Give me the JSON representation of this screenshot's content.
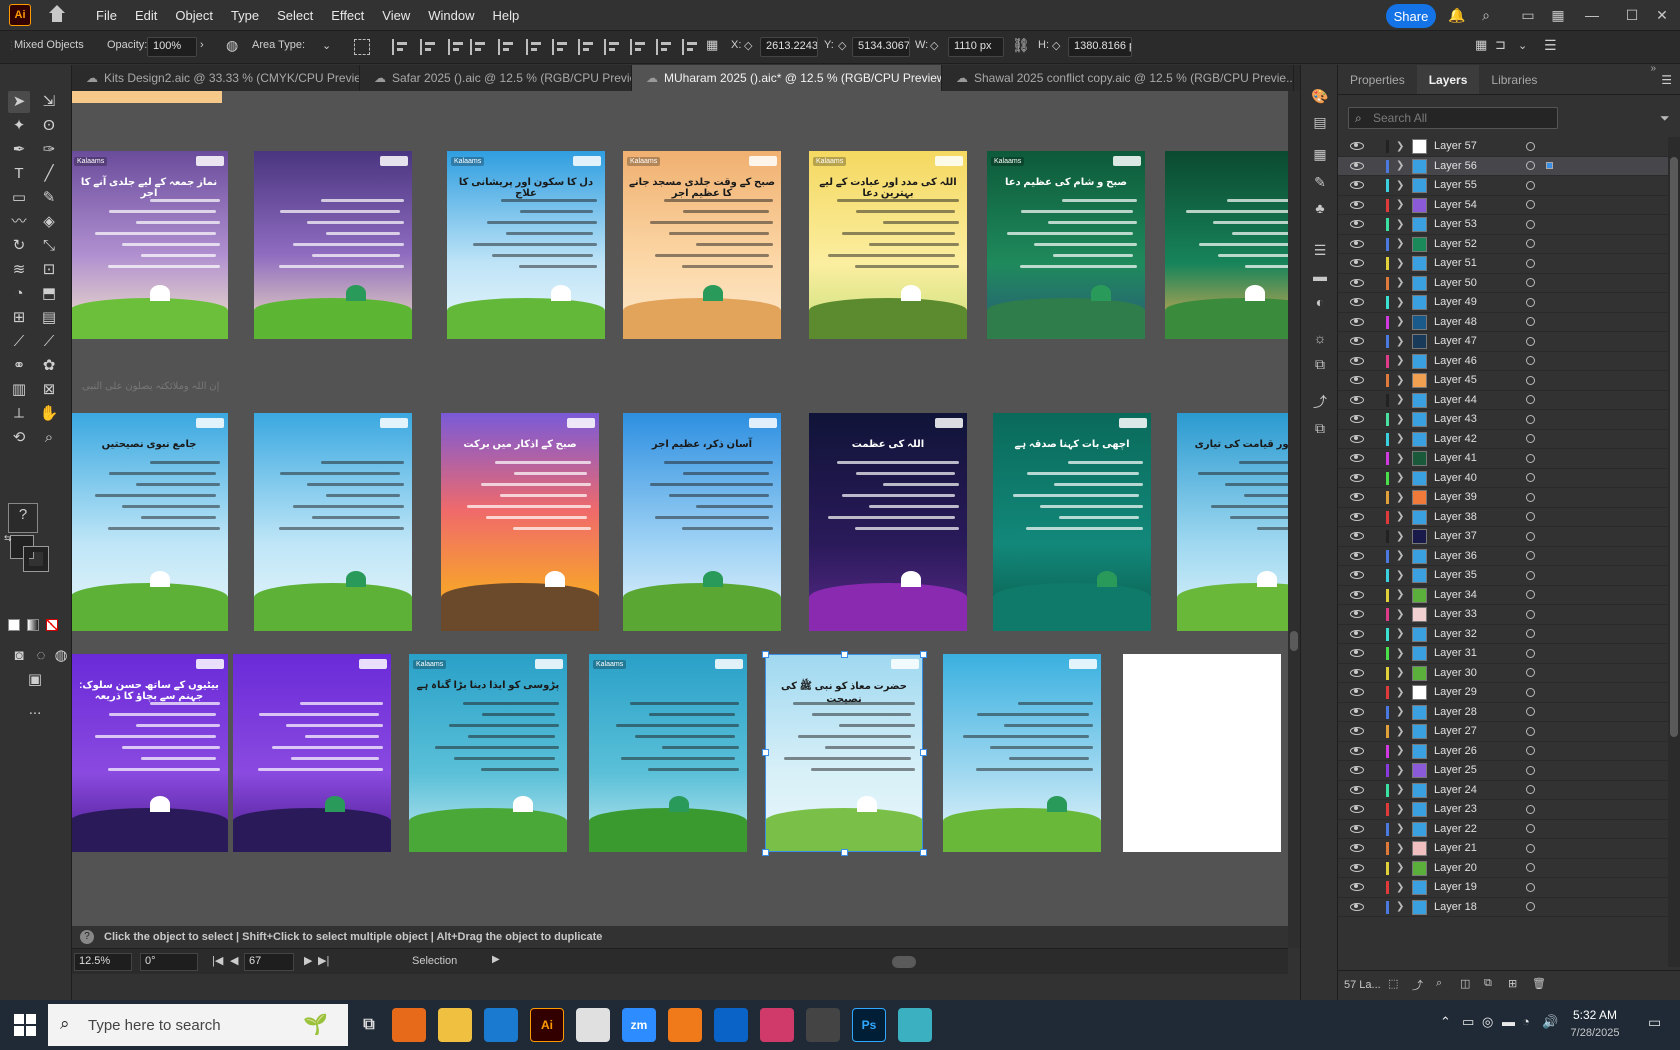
{
  "menubar": {
    "app_logo": "Ai",
    "items": [
      "File",
      "Edit",
      "Object",
      "Type",
      "Select",
      "Effect",
      "View",
      "Window",
      "Help"
    ],
    "share": "Share"
  },
  "control": {
    "selection_type": "Mixed Objects",
    "opacity_label": "Opacity:",
    "opacity_value": "100%",
    "area_type_label": "Area Type:",
    "x_label": "X:",
    "x_value": "2613.2243 p",
    "y_label": "Y:",
    "y_value": "5134.3067 p",
    "w_label": "W:",
    "w_value": "1110 px",
    "h_label": "H:",
    "h_value": "1380.8166 p"
  },
  "tabs": [
    {
      "label": "Kits Design2.aic @ 33.33 % (CMYK/CPU Previe...",
      "active": false
    },
    {
      "label": "Safar 2025 ().aic @ 12.5 % (RGB/CPU Previe...",
      "active": false
    },
    {
      "label": "MUharam 2025 ().aic* @ 12.5 % (RGB/CPU Preview)",
      "active": true
    },
    {
      "label": "Shawal 2025 conflict copy.aic @ 12.5 % (RGB/CPU Previe...",
      "active": false
    }
  ],
  "toolbar": {
    "help_glyph": "?",
    "more": "..."
  },
  "artboards_row1": [
    {
      "title": "نماز جمعہ کے لیے جلدی آنے کا اجر",
      "logo": "Kalaams",
      "bg": "linear-gradient(#6a4c9c,#b08fd0 55%,#f3e6c8)",
      "ground": "#6bbf3b"
    },
    {
      "title": "",
      "logo": "",
      "bg": "linear-gradient(#4a3580,#8f6cc0 55%,#f1e0c0)",
      "ground": "#5db534"
    },
    {
      "title": "دل کا سکون اور پریشانی کا علاج",
      "logo": "Kalaams",
      "bg": "linear-gradient(#2f9ee0,#bfe4f7 60%,#e9f6fb)",
      "ground": "#63b83a"
    },
    {
      "title": "صبح کے وقت جلدی مسجد جانے کا عظیم اجر",
      "logo": "Kalaams",
      "bg": "linear-gradient(#f0b070,#fcd8a8 60%,#fde8cc)",
      "ground": "#e2a35a"
    },
    {
      "title": "اللہ کی مدد اور عبادت کے لیے بہترین دعا",
      "logo": "Kalaams",
      "bg": "linear-gradient(#f4d860,#fbeea0 60%,#c9e07a)",
      "ground": "#5c8a2e"
    },
    {
      "title": "صبح و شام کی عظیم دعا",
      "logo": "Kalaams",
      "bg": "linear-gradient(#0d5a3a,#1f8a5c 60%,#2a5a7a)",
      "ground": "#2e7d4a"
    },
    {
      "title": "",
      "logo": "",
      "bg": "linear-gradient(#0b4a30,#17845a 60%,#f0b050)",
      "ground": "#3b8b3c"
    }
  ],
  "artboards_row2": [
    {
      "title": "جامع نبوی نصیحتیں",
      "logo": "",
      "bg": "linear-gradient(#3aa8e0,#bfe6f7 60%,#e8f6fb)",
      "ground": "#5cb136"
    },
    {
      "title": "",
      "logo": "",
      "bg": "linear-gradient(#3aa8e0,#bfe6f7 60%,#e8f6fb)",
      "ground": "#5cb136"
    },
    {
      "title": "صبح کے اذکار میں برکت",
      "logo": "",
      "bg": "linear-gradient(#7a5ad8,#f06a6a 45%,#f7a030 80%)",
      "ground": "#6a4a2a"
    },
    {
      "title": "آسان ذکر، عظیم اجر",
      "logo": "",
      "bg": "linear-gradient(#2d8fe0,#9fd2f5 60%,#e6f4fb)",
      "ground": "#5aa833"
    },
    {
      "title": "اللہ کی عظمت",
      "logo": "",
      "bg": "linear-gradient(#101438,#2a1a5a 60%,#5a2a8a)",
      "ground": "#8a2ab0"
    },
    {
      "title": "اچھی بات کہنا صدقہ ہے",
      "logo": "",
      "bg": "linear-gradient(#0a6a5a,#12887a 60%,#0a5a4a)",
      "ground": "#0f7a6a"
    },
    {
      "title": "موت اور قیامت کی تیاری",
      "logo": "",
      "bg": "linear-gradient(#2a9ad0,#9fd8f0 60%,#e0f4fb)",
      "ground": "#6ab83a"
    }
  ],
  "artboards_row3": [
    {
      "title": "بیٹیوں کے ساتھ حسن سلوک: جہنم سے بچاؤ کا ذریعہ",
      "logo": "",
      "bg": "linear-gradient(#6a2ad8,#8a4ae0 60%,#4a1a8a)",
      "ground": "#2a1a5a"
    },
    {
      "title": "",
      "logo": "",
      "bg": "linear-gradient(#6a2ad8,#8a4ae0 60%,#4a1a8a)",
      "ground": "#2a1a5a"
    },
    {
      "title": "پڑوسی کو ایذا دینا بڑا گناہ ہے",
      "logo": "Kalaams",
      "bg": "linear-gradient(#2aa0c8,#5ac0d8 60%,#bfe8f0)",
      "ground": "#4aa838"
    },
    {
      "title": "",
      "logo": "Kalaams",
      "bg": "linear-gradient(#2aa0c8,#5ac0d8 60%,#bfe8f0)",
      "ground": "#3a9a30"
    },
    {
      "title": "حضرت معاذ کو نبی ﷺ کی نصیحت",
      "logo": "",
      "bg": "linear-gradient(#9fd8f0,#d8f0f8 60%,#e8f6fb)",
      "ground": "#7ac048"
    },
    {
      "title": "",
      "logo": "",
      "bg": "linear-gradient(#3ab0e0,#9fd8f0 60%,#e8f6fb)",
      "ground": "#6ab83a"
    },
    {
      "title": "",
      "logo": "",
      "bg": "#ffffff",
      "ground": "#ffffff"
    }
  ],
  "stray_text": "إن اللہ وملائکتہ یصلون علی النبی",
  "status": {
    "hint": "Click the object to select  |  Shift+Click to select multiple object  |  Alt+Drag the object to duplicate",
    "zoom": "12.5%",
    "rotation": "0°",
    "artboard_num": "67",
    "mode": "Selection"
  },
  "panel": {
    "tabs": [
      "Properties",
      "Layers",
      "Libraries"
    ],
    "active_tab": "Layers",
    "search_placeholder": "Search All",
    "footer_count": "57 La..."
  },
  "layers": [
    {
      "name": "Layer 57",
      "color": "#222222",
      "thumb": "#ffffff"
    },
    {
      "name": "Layer 56",
      "color": "#4a7ae0",
      "thumb": "#3aa0e0",
      "active": true
    },
    {
      "name": "Layer 55",
      "color": "#3ad0e0",
      "thumb": "#3aa0e0"
    },
    {
      "name": "Layer 54",
      "color": "#e03a3a",
      "thumb": "#8a5ad8"
    },
    {
      "name": "Layer 53",
      "color": "#3ae0a0",
      "thumb": "#3aa0e0"
    },
    {
      "name": "Layer 52",
      "color": "#4a7ae0",
      "thumb": "#1a8a5a"
    },
    {
      "name": "Layer 51",
      "color": "#e0d03a",
      "thumb": "#3aa0e0"
    },
    {
      "name": "Layer 50",
      "color": "#e07a3a",
      "thumb": "#3aa0e0"
    },
    {
      "name": "Layer 49",
      "color": "#3ae0d0",
      "thumb": "#3aa0e0"
    },
    {
      "name": "Layer 48",
      "color": "#d03ae0",
      "thumb": "#1a5a8a"
    },
    {
      "name": "Layer 47",
      "color": "#4a7ae0",
      "thumb": "#1a3a5a"
    },
    {
      "name": "Layer 46",
      "color": "#e03a8a",
      "thumb": "#3aa0e0"
    },
    {
      "name": "Layer 45",
      "color": "#e07a3a",
      "thumb": "#f0a050"
    },
    {
      "name": "Layer 44",
      "color": "#222222",
      "thumb": "#3aa0e0"
    },
    {
      "name": "Layer 43",
      "color": "#4ae0a0",
      "thumb": "#3aa0e0"
    },
    {
      "name": "Layer 42",
      "color": "#3ad0e0",
      "thumb": "#3aa0e0"
    },
    {
      "name": "Layer 41",
      "color": "#d03ae0",
      "thumb": "#1a5a3a"
    },
    {
      "name": "Layer 40",
      "color": "#4ae04a",
      "thumb": "#3aa0e0"
    },
    {
      "name": "Layer 39",
      "color": "#e0a03a",
      "thumb": "#f07a3a"
    },
    {
      "name": "Layer 38",
      "color": "#e03a3a",
      "thumb": "#3aa0e0"
    },
    {
      "name": "Layer 37",
      "color": "#222222",
      "thumb": "#1a1a4a"
    },
    {
      "name": "Layer 36",
      "color": "#4a7ae0",
      "thumb": "#3aa0e0"
    },
    {
      "name": "Layer 35",
      "color": "#3ad0e0",
      "thumb": "#3aa0e0"
    },
    {
      "name": "Layer 34",
      "color": "#e0d03a",
      "thumb": "#5ab03a"
    },
    {
      "name": "Layer 33",
      "color": "#e03a8a",
      "thumb": "#f0d0d0"
    },
    {
      "name": "Layer 32",
      "color": "#3ae0d0",
      "thumb": "#3aa0e0"
    },
    {
      "name": "Layer 31",
      "color": "#4ae04a",
      "thumb": "#3aa0e0"
    },
    {
      "name": "Layer 30",
      "color": "#e0d03a",
      "thumb": "#5ab03a"
    },
    {
      "name": "Layer 29",
      "color": "#e03a3a",
      "thumb": "#ffffff"
    },
    {
      "name": "Layer 28",
      "color": "#4a7ae0",
      "thumb": "#3aa0e0"
    },
    {
      "name": "Layer 27",
      "color": "#e0a03a",
      "thumb": "#3aa0e0"
    },
    {
      "name": "Layer 26",
      "color": "#d03ae0",
      "thumb": "#3aa0e0"
    },
    {
      "name": "Layer 25",
      "color": "#8a3ae0",
      "thumb": "#8a5ad8"
    },
    {
      "name": "Layer 24",
      "color": "#3ae0a0",
      "thumb": "#3aa0e0"
    },
    {
      "name": "Layer 23",
      "color": "#e03a3a",
      "thumb": "#3aa0e0"
    },
    {
      "name": "Layer 22",
      "color": "#4a7ae0",
      "thumb": "#3aa0e0"
    },
    {
      "name": "Layer 21",
      "color": "#e07a3a",
      "thumb": "#f0c0c0"
    },
    {
      "name": "Layer 20",
      "color": "#e0d03a",
      "thumb": "#5ab03a"
    },
    {
      "name": "Layer 19",
      "color": "#e03a3a",
      "thumb": "#3aa0e0"
    },
    {
      "name": "Layer 18",
      "color": "#4a7ae0",
      "thumb": "#3aa0e0"
    }
  ],
  "taskbar": {
    "search_placeholder": "Type here to search",
    "time": "5:32 AM",
    "date": "7/28/2025",
    "apps": [
      {
        "name": "firefox",
        "label": "",
        "color": "#e66a1a"
      },
      {
        "name": "explorer",
        "label": "",
        "color": "#f0c040"
      },
      {
        "name": "vscode",
        "label": "",
        "color": "#1a7ad0"
      },
      {
        "name": "illustrator",
        "label": "Ai",
        "color": "#330000"
      },
      {
        "name": "chrome",
        "label": "",
        "color": "#e0e0e0"
      },
      {
        "name": "zoom",
        "label": "zm",
        "color": "#2d8cff"
      },
      {
        "name": "xampp",
        "label": "",
        "color": "#f07a1a"
      },
      {
        "name": "outlook",
        "label": "",
        "color": "#0a64c8"
      },
      {
        "name": "creative-cloud",
        "label": "",
        "color": "#d03a6a"
      },
      {
        "name": "tool",
        "label": "",
        "color": "#444444"
      },
      {
        "name": "photoshop",
        "label": "Ps",
        "color": "#001e36"
      },
      {
        "name": "app-gem",
        "label": "",
        "color": "#3ab0c0"
      }
    ]
  }
}
